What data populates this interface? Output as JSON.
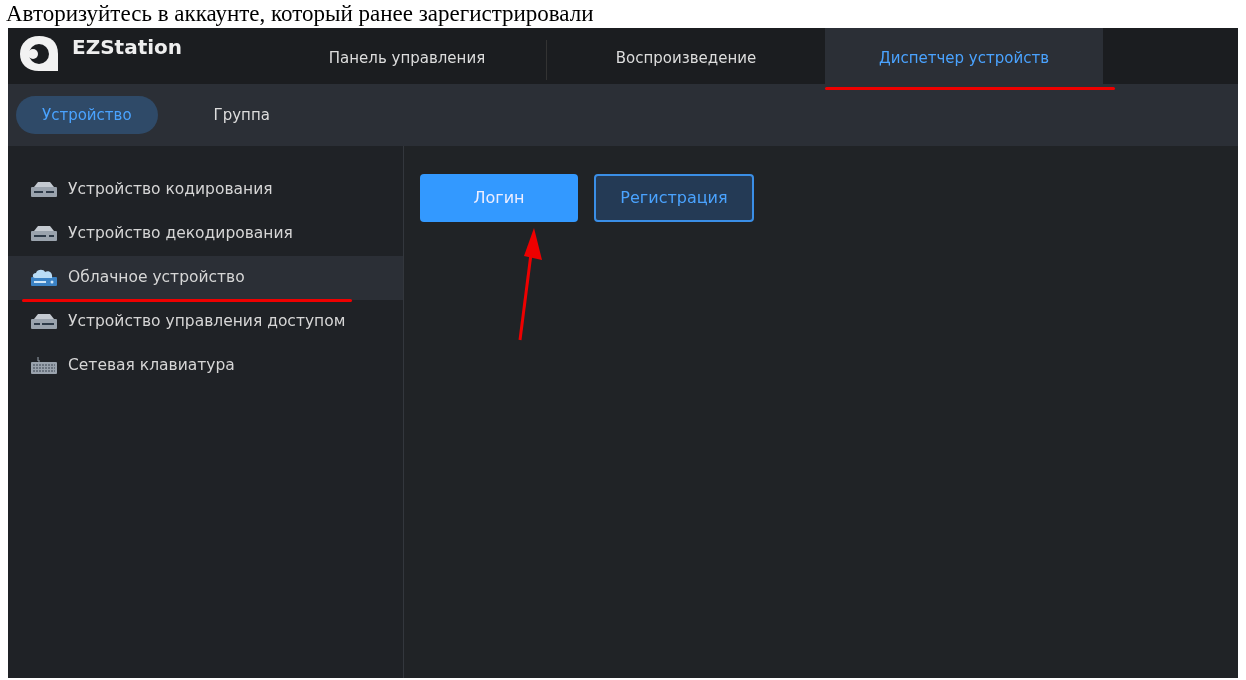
{
  "caption": "Авторизуйтесь в аккаунте, который ранее зарегистрировали",
  "app": {
    "name": "EZStation"
  },
  "tabs": [
    {
      "label": "Панель управления",
      "selected": false,
      "annotated": false
    },
    {
      "label": "Воспроизведение",
      "selected": false,
      "annotated": false
    },
    {
      "label": "Диспетчер устройств",
      "selected": true,
      "annotated": true
    }
  ],
  "subtabs": [
    {
      "label": "Устройство",
      "selected": true
    },
    {
      "label": "Группа",
      "selected": false
    }
  ],
  "sidebar": {
    "items": [
      {
        "label": "Устройство кодирования",
        "kind": "encoder",
        "selected": false,
        "annotated": false
      },
      {
        "label": "Устройство декодирования",
        "kind": "decoder",
        "selected": false,
        "annotated": false
      },
      {
        "label": "Облачное устройство",
        "kind": "cloud",
        "selected": true,
        "annotated": true
      },
      {
        "label": "Устройство управления доступом",
        "kind": "access",
        "selected": false,
        "annotated": false
      },
      {
        "label": "Сетевая клавиатура",
        "kind": "keyboard",
        "selected": false,
        "annotated": false
      }
    ]
  },
  "buttons": [
    {
      "label": "Логин",
      "kind": "primary",
      "annotated": true
    },
    {
      "label": "Регистрация",
      "kind": "outline",
      "annotated": false
    }
  ]
}
